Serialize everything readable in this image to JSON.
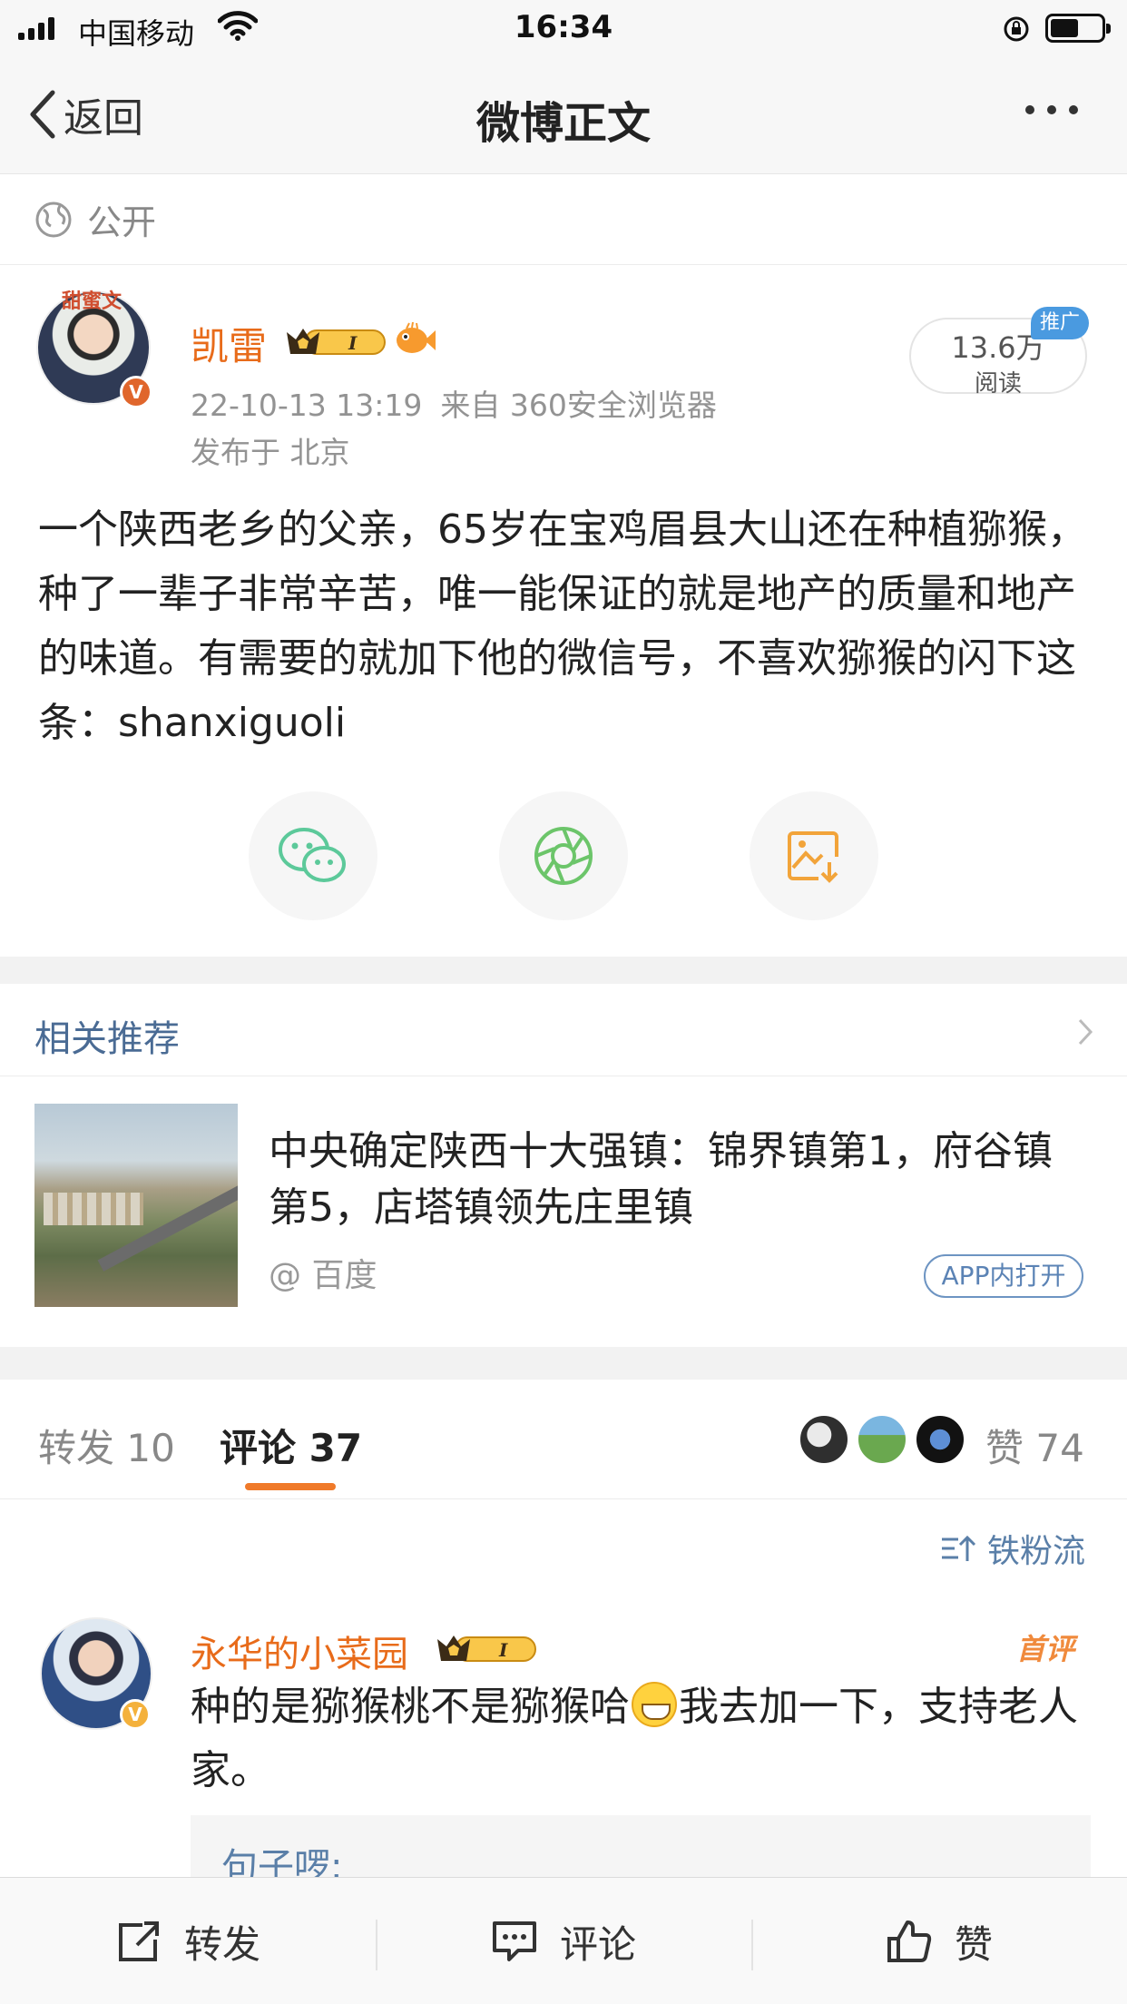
{
  "status_bar": {
    "carrier": "中国移动",
    "time": "16:34",
    "battery_level": 0.55
  },
  "nav": {
    "back_label": "返回",
    "title": "微博正文"
  },
  "visibility": {
    "label": "公开"
  },
  "post": {
    "author": "凯雷",
    "avatar_badge": "甜蜜文",
    "vip_level": "I",
    "timestamp": "22-10-13 13:19",
    "source": "来自 360安全浏览器",
    "location": "发布于 北京",
    "read_count": "13.6万",
    "read_label": "阅读",
    "promo_tag": "推广",
    "text": "一个陕西老乡的父亲，65岁在宝鸡眉县大山还在种植猕猴，种了一辈子非常辛苦，唯一能保证的就是地产的质量和地产的味道。有需要的就加下他的微信号，不喜欢猕猴的闪下这条：shanxiguoli"
  },
  "share": [
    {
      "icon": "wechat-icon",
      "color": "#5cc99a"
    },
    {
      "icon": "moments-icon",
      "color": "#6cc56a"
    },
    {
      "icon": "save-image-icon",
      "color": "#f2a43a"
    }
  ],
  "related": {
    "title": "相关推荐",
    "headline": "中央确定陕西十大强镇：锦界镇第1，府谷镇第5，店塔镇领先庄里镇",
    "source": "@ 百度",
    "open_label": "APP内打开"
  },
  "tabs": {
    "repost": "转发 10",
    "comments": "评论 37",
    "likes": "赞 74"
  },
  "sort": {
    "label": "铁粉流"
  },
  "comment": {
    "author": "永华的小菜园",
    "vip_level": "I",
    "first_tag": "首评",
    "text_before": "种的是猕猴桃不是猕猴哈",
    "text_after": "我去加一下，支持老人家。",
    "reply_author": "句子啰:"
  },
  "toolbar": {
    "repost": "转发",
    "comment": "评论",
    "like": "赞"
  },
  "colors": {
    "accent": "#f07a2a",
    "link": "#5a7fa8",
    "name": "#e86b1a"
  }
}
